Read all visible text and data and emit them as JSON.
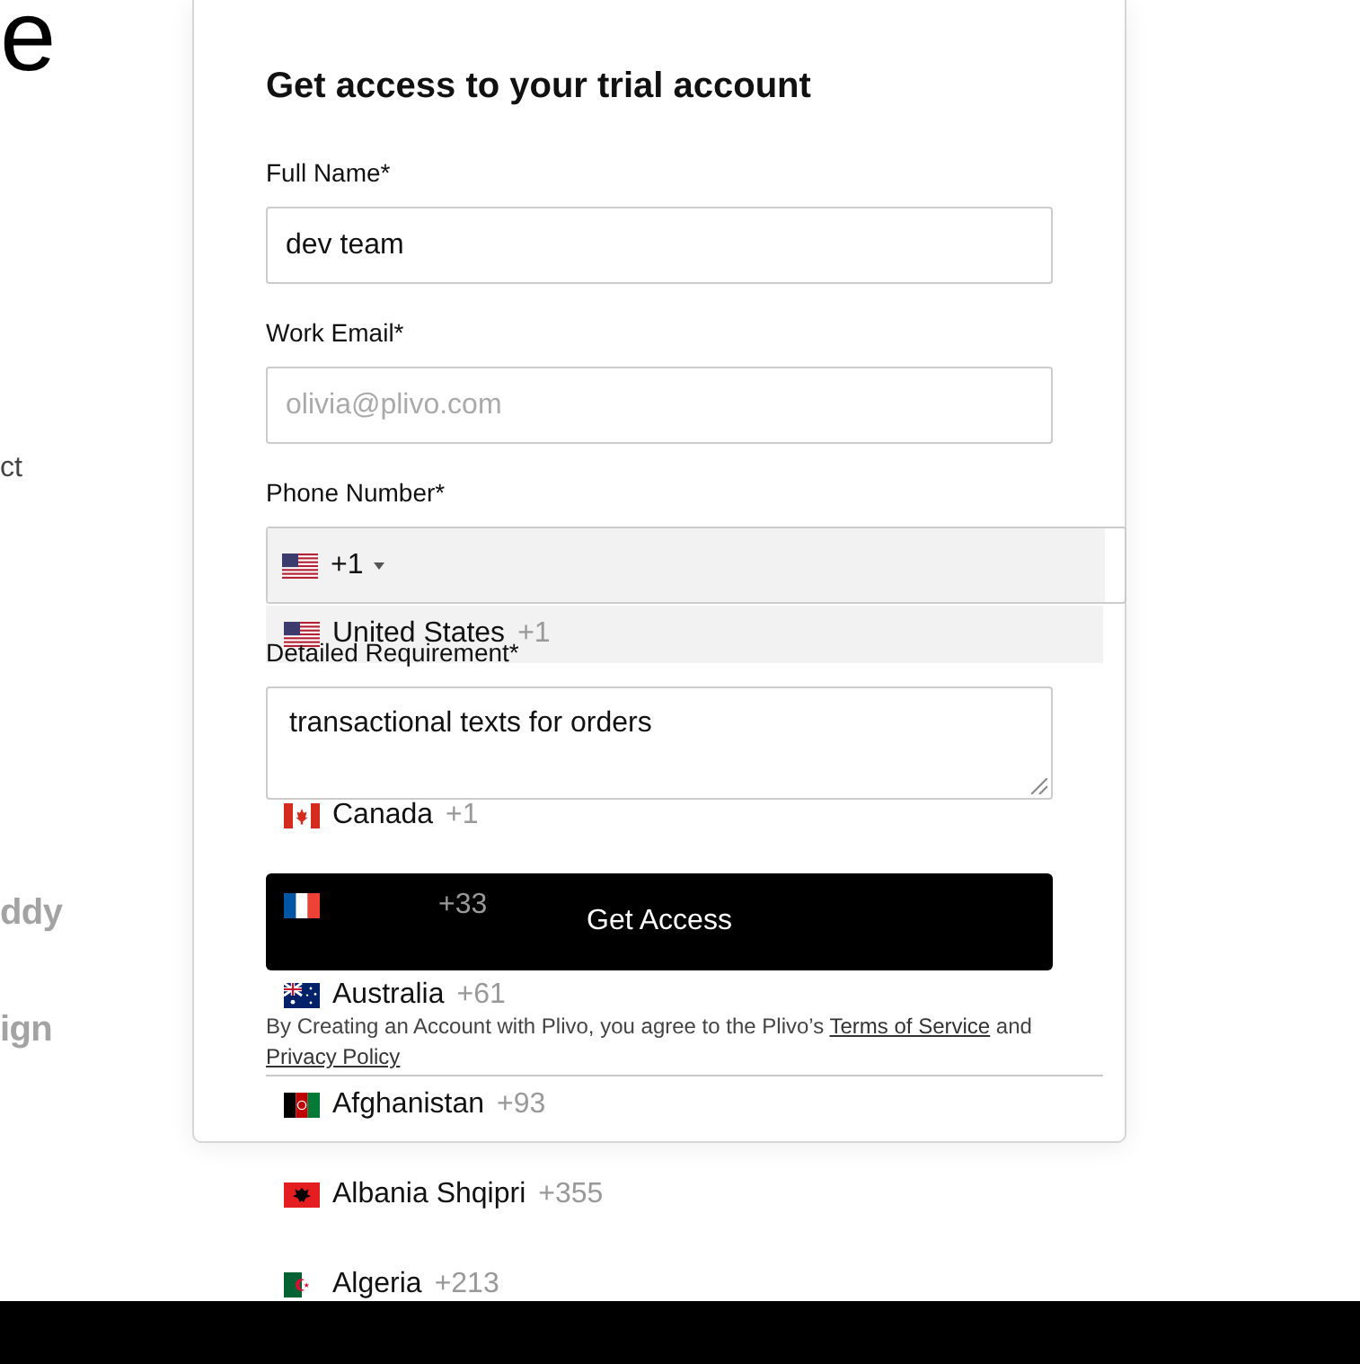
{
  "side": {
    "heading": "e",
    "text": "ct",
    "logos": [
      "ddy",
      "ign"
    ]
  },
  "form": {
    "title": "Get access to your trial account",
    "fields": [
      {
        "kind": "text",
        "label": "Full Name*",
        "value": "dev team"
      },
      {
        "kind": "email",
        "label": "Work Email*",
        "placeholder": "olivia@plivo.com"
      },
      {
        "kind": "phone",
        "label": "Phone Number*",
        "country": {
          "kind": "usa",
          "dial_code": "+1"
        },
        "expanded": true,
        "preferred_countries": [
          {
            "kind": "usa",
            "name": "United States",
            "dial_code": "+1",
            "selected": true
          },
          {
            "kind": "canada",
            "name": "Canada",
            "dial_code": "+1",
            "selected": false
          },
          {
            "kind": "france",
            "dial_code": "+33",
            "selected": false
          },
          {
            "kind": "australia",
            "name": "Australia",
            "dial_code": "+61",
            "selected": false
          }
        ],
        "all_countries": [
          {
            "kind": "afghanistan",
            "name": "Afghanistan",
            "dial_code": "+93",
            "selected": false
          },
          {
            "kind": "albania",
            "name": "Albania Shqipri",
            "dial_code": "+355",
            "selected": false
          },
          {
            "kind": "algeria",
            "name": "Algeria",
            "dial_code": "+213",
            "selected": false
          }
        ]
      },
      {
        "kind": "textarea",
        "label": "Detailed Requirement*",
        "value": "transactional texts for orders"
      }
    ],
    "submit": "Get Access",
    "consent": [
      {
        "kind": "text",
        "text": "By Creating an Account with Plivo, you agree to the Plivo’s "
      },
      {
        "kind": "link",
        "text": "Terms of Service"
      },
      {
        "kind": "text",
        "text": " and "
      },
      {
        "kind": "link",
        "text": "Privacy Policy"
      }
    ]
  }
}
